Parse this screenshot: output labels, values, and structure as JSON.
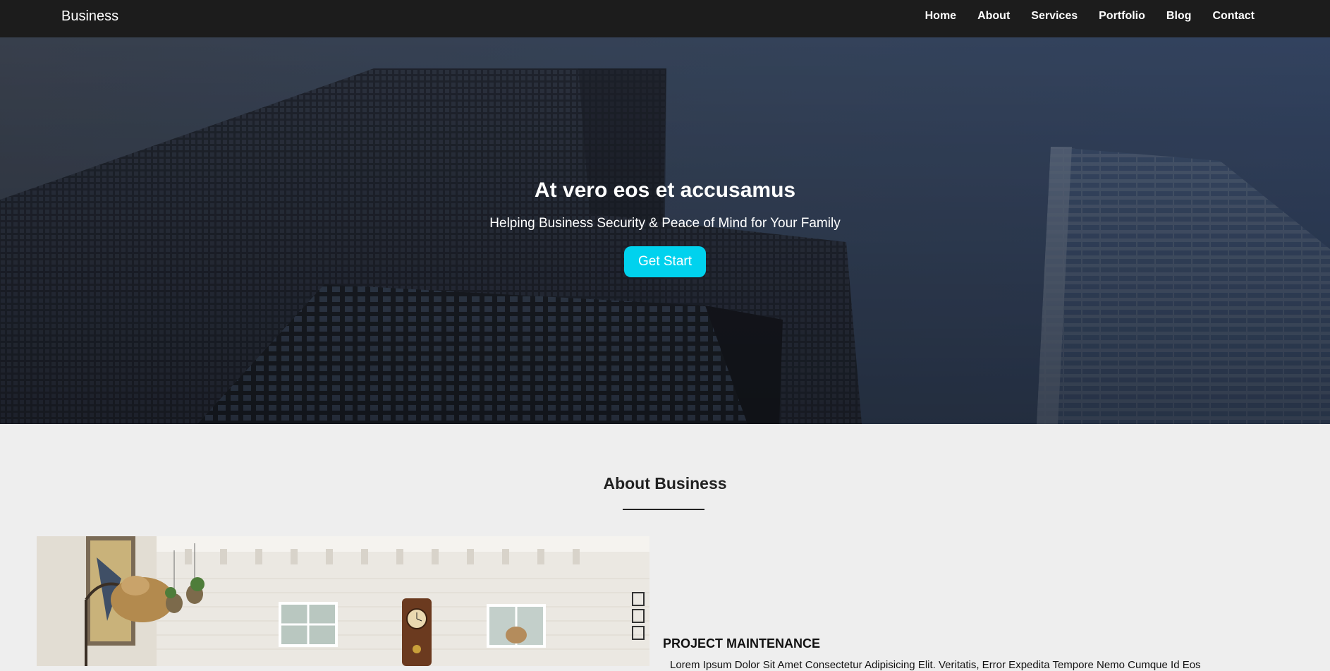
{
  "nav": {
    "brand": "Business",
    "links": [
      "Home",
      "About",
      "Services",
      "Portfolio",
      "Blog",
      "Contact"
    ]
  },
  "hero": {
    "title": "At vero eos et accusamus",
    "subtitle": "Helping Business Security & Peace of Mind for Your Family",
    "button_label": "Get Start",
    "button_color": "#00d2ee"
  },
  "about": {
    "title": "About Business",
    "project_title": "PROJECT MAINTENANCE",
    "project_text": "Lorem Ipsum Dolor Sit Amet Consectetur Adipisicing Elit. Veritatis, Error Expedita Tempore Nemo Cumque Id Eos"
  }
}
